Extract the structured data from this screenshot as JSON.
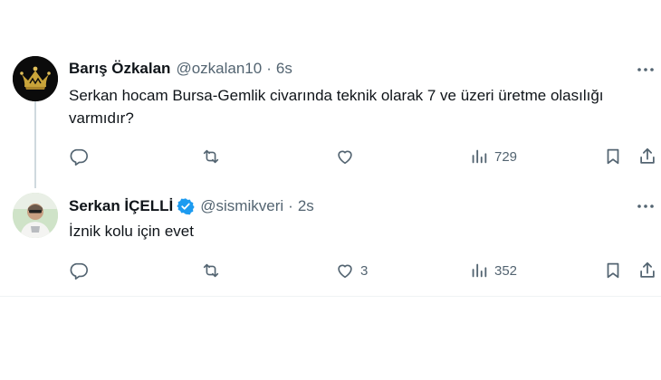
{
  "tweets": [
    {
      "author_name": "Barış Özkalan",
      "handle": "@ozkalan10",
      "separator": "·",
      "time": "6s",
      "verified": false,
      "text": "Serkan hocam Bursa-Gemlik civarında teknik olarak 7 ve üzeri üretme olasılığı varmıdır?",
      "replies": "",
      "retweets": "",
      "likes": "",
      "views": "729"
    },
    {
      "author_name": "Serkan İÇELLİ",
      "handle": "@sismikveri",
      "separator": "·",
      "time": "2s",
      "verified": true,
      "text": "İznik kolu için evet",
      "replies": "",
      "retweets": "",
      "likes": "3",
      "views": "352"
    }
  ],
  "icons": {
    "reply": "reply-icon",
    "retweet": "retweet-icon",
    "like": "heart-icon",
    "views": "views-icon",
    "bookmark": "bookmark-icon",
    "share": "share-icon",
    "more": "more-icon",
    "verified": "verified-badge-icon"
  },
  "colors": {
    "text": "#0f1419",
    "secondary": "#536471",
    "verified": "#1d9bf0",
    "thread_line": "#cfd9de"
  }
}
